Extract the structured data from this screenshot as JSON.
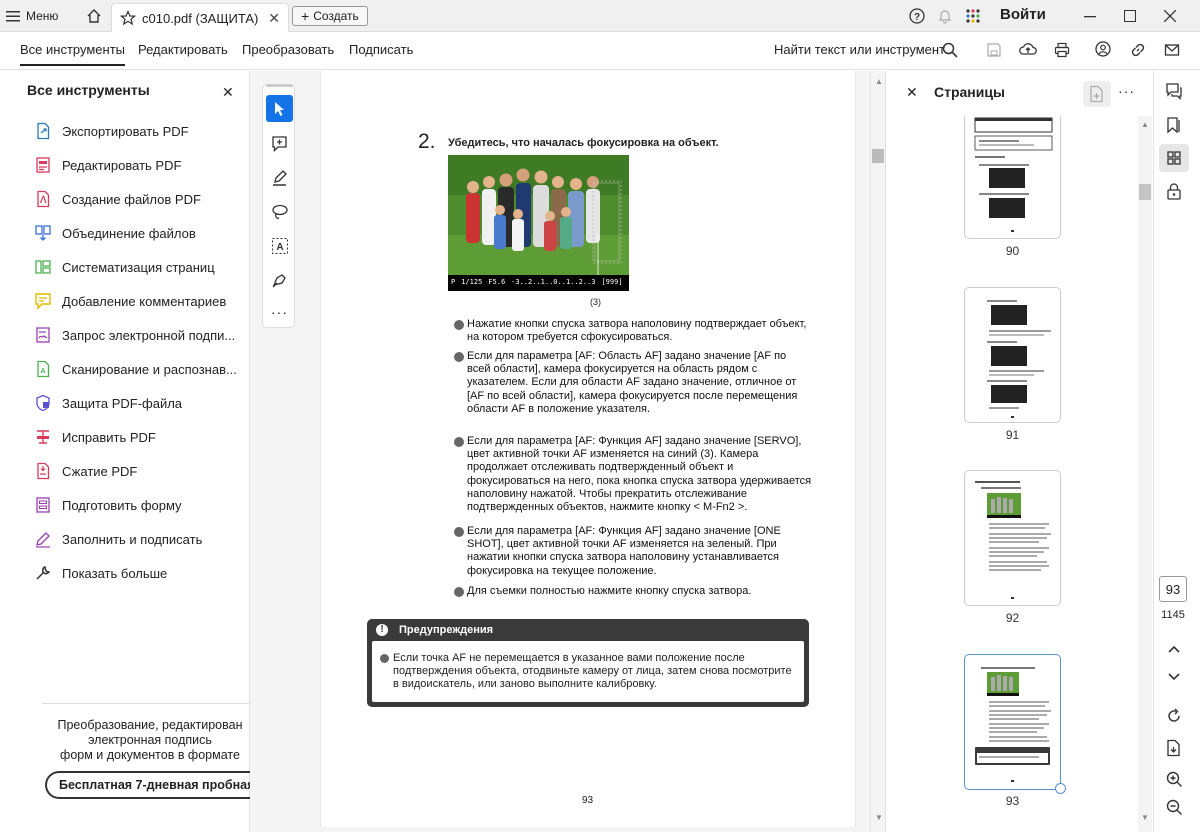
{
  "titlebar": {
    "menu_label": "Меню",
    "tab_title": "c010.pdf (ЗАЩИТА)",
    "create_label": "Создать",
    "signin_label": "Войти"
  },
  "menubar": {
    "items": [
      "Все инструменты",
      "Редактировать",
      "Преобразовать",
      "Подписать"
    ],
    "active": "Все инструменты",
    "search_label": "Найти текст или инструмент"
  },
  "left_panel": {
    "title": "Все инструменты",
    "tools": [
      {
        "label": "Экспортировать PDF",
        "icon": "export-pdf-icon",
        "color": "#2b7bb9"
      },
      {
        "label": "Редактировать PDF",
        "icon": "edit-pdf-icon",
        "color": "#d63b5c"
      },
      {
        "label": "Создание файлов PDF",
        "icon": "create-pdf-icon",
        "color": "#d63b5c"
      },
      {
        "label": "Объединение файлов",
        "icon": "combine-files-icon",
        "color": "#3a6fd8"
      },
      {
        "label": "Систематизация страниц",
        "icon": "organize-pages-icon",
        "color": "#4caf50"
      },
      {
        "label": "Добавление комментариев",
        "icon": "comment-icon",
        "color": "#e6b800"
      },
      {
        "label": "Запрос электронной подпи...",
        "icon": "request-signature-icon",
        "color": "#9b3fb5"
      },
      {
        "label": "Сканирование и распознав...",
        "icon": "scan-ocr-icon",
        "color": "#4caf50"
      },
      {
        "label": "Защита PDF-файла",
        "icon": "protect-pdf-icon",
        "color": "#5b4fd6"
      },
      {
        "label": "Исправить PDF",
        "icon": "redact-pdf-icon",
        "color": "#d63b5c"
      },
      {
        "label": "Сжатие PDF",
        "icon": "compress-pdf-icon",
        "color": "#d63b5c"
      },
      {
        "label": "Подготовить форму",
        "icon": "prepare-form-icon",
        "color": "#9b3fb5"
      },
      {
        "label": "Заполнить и подписать",
        "icon": "fill-sign-icon",
        "color": "#9b3fb5"
      },
      {
        "label": "Показать больше",
        "icon": "wrench-icon",
        "color": "#333333"
      }
    ],
    "promo_line1": "Преобразование, редактирован",
    "promo_line2": "электронная подпись",
    "promo_line3": "форм и документов в формате",
    "trial_button": "Бесплатная 7-дневная пробная"
  },
  "document": {
    "step_number": "2.",
    "step_title": "Убедитесь, что началась фокусировка на объект.",
    "viewfinder": {
      "mode": "P",
      "shutter": "1/125",
      "aperture": "F5.6",
      "exposure_scale": "-3..2..1..0..1..2..3",
      "iso_shots": "[999]"
    },
    "callout": "(3)",
    "bullets": [
      "Нажатие кнопки спуска затвора наполовину подтверждает объект, на котором требуется сфокусироваться.",
      "Если для параметра [AF: Область AF] задано значение [AF по всей области], камера фокусируется на область рядом с указателем. Если для области AF задано значение, отличное от [AF по всей области], камера фокусируется после перемещения области AF в положение указателя.",
      "Если для параметра [AF: Функция AF] задано значение [SERVO], цвет активной точки AF изменяется на синий (3). Камера продолжает отслеживать подтвержденный объект и фокусироваться на него, пока кнопка спуска затвора удерживается наполовину нажатой. Чтобы прекратить отслеживание подтвержденных объектов, нажмите кнопку < M-Fn2 >.",
      "Если для параметра [AF: Функция AF] задано значение [ONE SHOT], цвет активной точки AF изменяется на зеленый. При нажатии кнопки спуска затвора наполовину устанавливается фокусировка на текущее положение.",
      "Для съемки полностью нажмите кнопку спуска затвора."
    ],
    "warning_title": "Предупреждения",
    "warning_text": "Если точка AF не перемещается в указанное вами положение после подтверждения объекта, отодвиньте камеру от лица, затем снова посмотрите в видоискатель, или заново выполните калибровку.",
    "page_number": "93"
  },
  "pages_panel": {
    "title": "Страницы",
    "pages": [
      "90",
      "91",
      "92",
      "93"
    ],
    "current_page": "93",
    "total_pages": "1145"
  },
  "colors": {
    "accent": "#1473e6",
    "warning_bg": "#3a3a3a"
  }
}
